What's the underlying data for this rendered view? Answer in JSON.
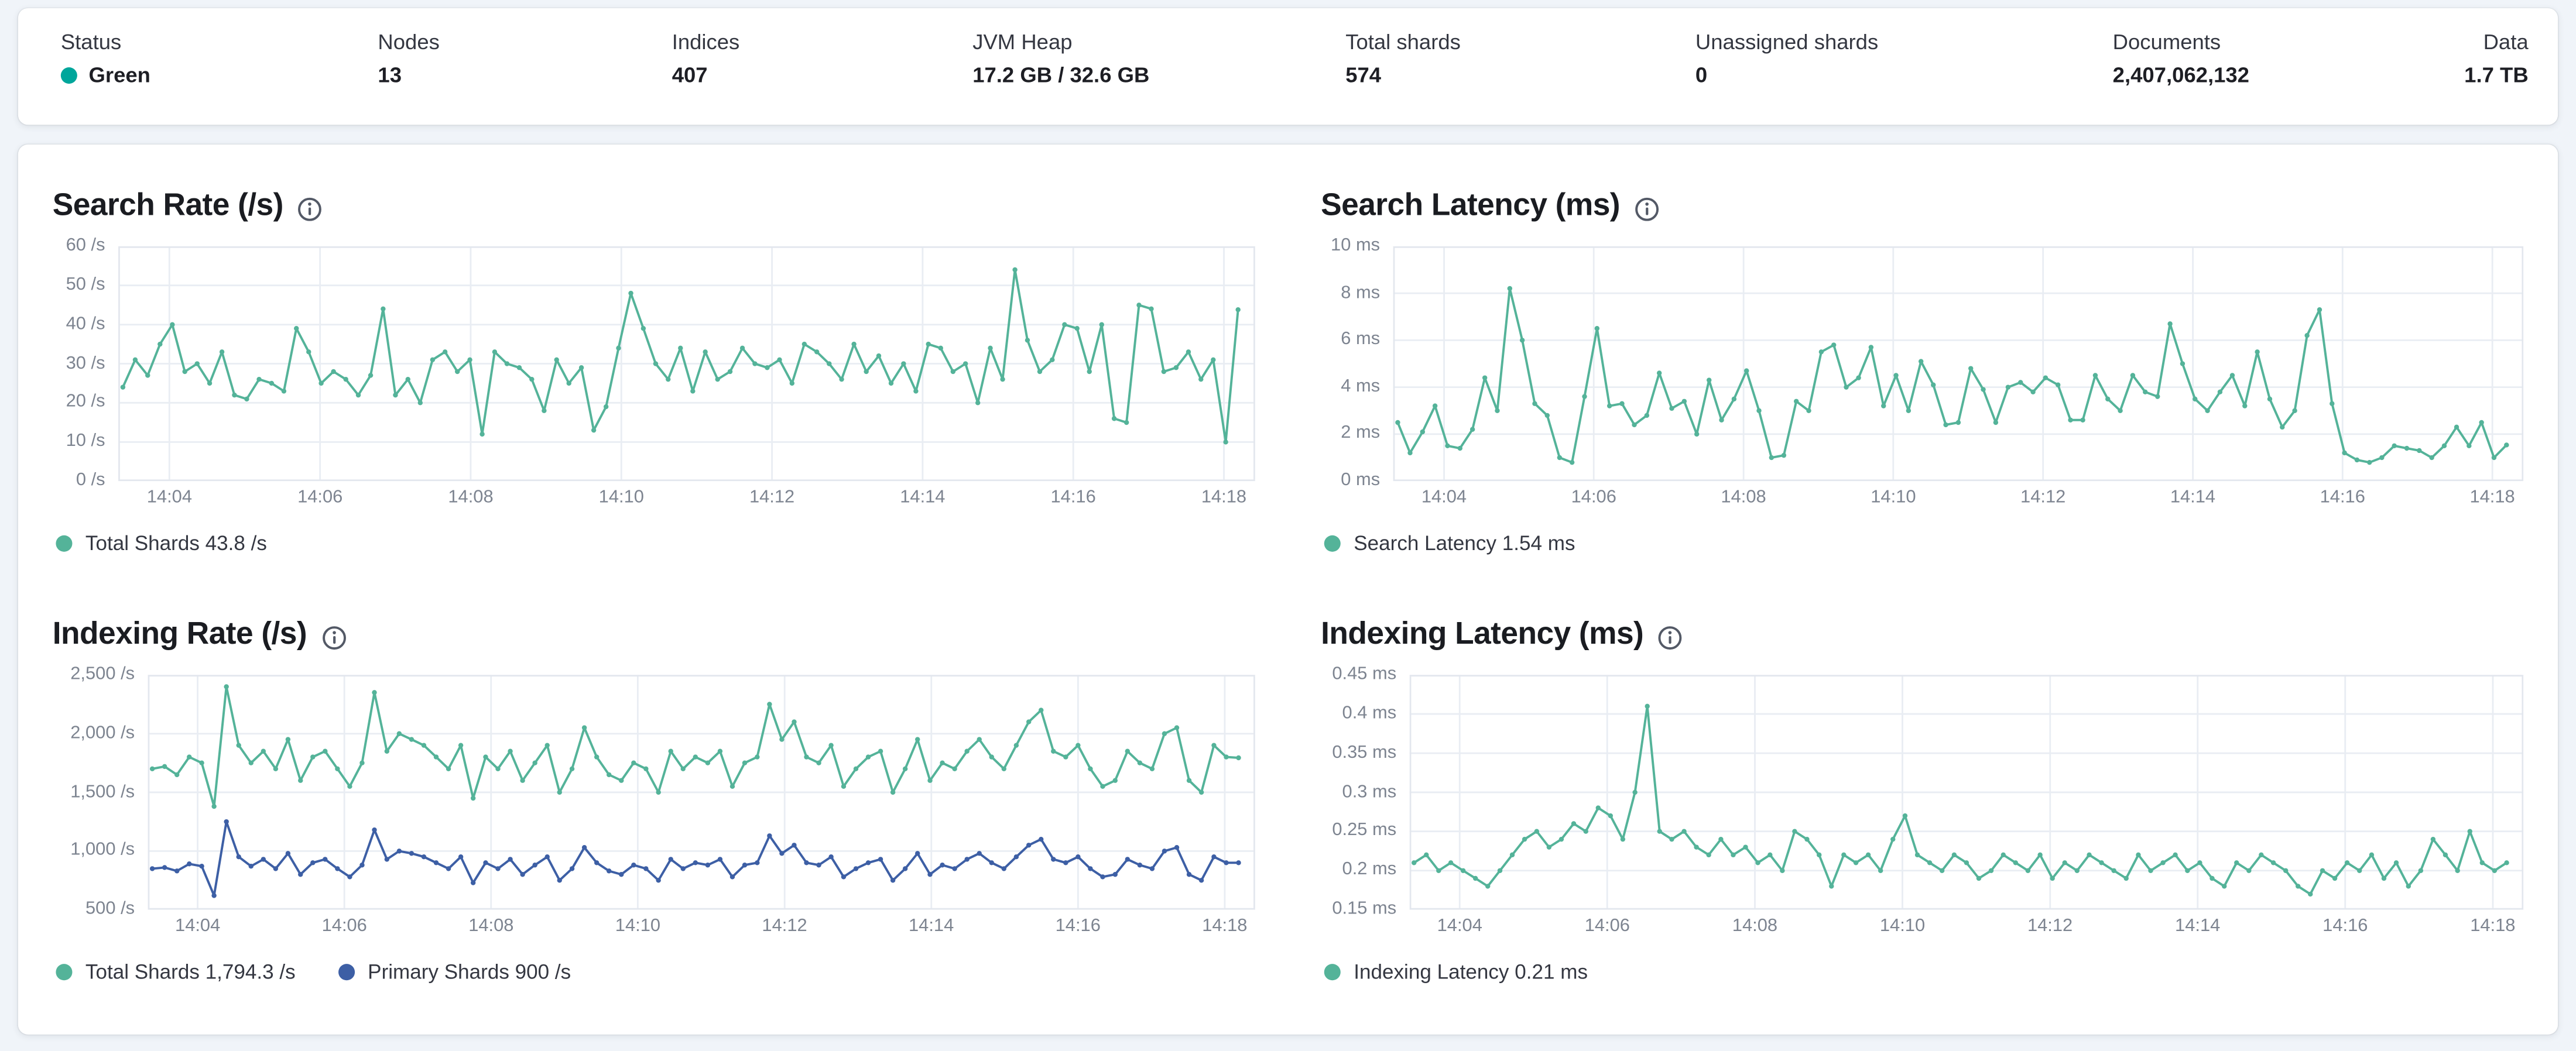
{
  "stats_bar": {
    "items": [
      {
        "label": "Status",
        "value": "Green",
        "type": "health"
      },
      {
        "label": "Nodes",
        "value": "13"
      },
      {
        "label": "Indices",
        "value": "407"
      },
      {
        "label": "JVM Heap",
        "value": "17.2 GB / 32.6 GB"
      },
      {
        "label": "Total shards",
        "value": "574"
      },
      {
        "label": "Unassigned shards",
        "value": "0"
      },
      {
        "label": "Documents",
        "value": "2,407,062,132"
      },
      {
        "label": "Data",
        "value": "1.7 TB"
      }
    ]
  },
  "colors": {
    "health_green": "#00a69b",
    "teal": "#54b399",
    "blue": "#3d5fa5",
    "grid": "#e9edf3",
    "page_bg": "#f0f4f9"
  },
  "chart_data": [
    {
      "type": "line",
      "title": "Search Rate (/s)",
      "ylabel": "/s",
      "ylim": [
        0,
        60
      ],
      "x_ticks": [
        "14:04",
        "14:06",
        "14:08",
        "14:10",
        "14:12",
        "14:14",
        "14:16",
        "14:18"
      ],
      "y_ticks": [
        {
          "v": 0,
          "label": "0 /s"
        },
        {
          "v": 10,
          "label": "10 /s"
        },
        {
          "v": 20,
          "label": "20 /s"
        },
        {
          "v": 30,
          "label": "30 /s"
        },
        {
          "v": 40,
          "label": "40 /s"
        },
        {
          "v": 50,
          "label": "50 /s"
        },
        {
          "v": 60,
          "label": "60 /s"
        }
      ],
      "series": [
        {
          "name": "Total Shards",
          "color": "#54b399",
          "values": [
            24,
            31,
            27,
            35,
            40,
            28,
            30,
            25,
            33,
            22,
            21,
            26,
            25,
            23,
            39,
            33,
            25,
            28,
            26,
            22,
            27,
            44,
            22,
            26,
            20,
            31,
            33,
            28,
            31,
            12,
            33,
            30,
            29,
            26,
            18,
            31,
            25,
            29,
            13,
            19,
            34,
            48,
            39,
            30,
            26,
            34,
            23,
            33,
            26,
            28,
            34,
            30,
            29,
            31,
            25,
            35,
            33,
            30,
            26,
            35,
            28,
            32,
            25,
            30,
            23,
            35,
            34,
            28,
            30,
            20,
            34,
            26,
            54,
            36,
            28,
            31,
            40,
            39,
            28,
            40,
            16,
            15,
            45,
            44,
            28,
            29,
            33,
            26,
            31,
            10,
            43.8
          ]
        }
      ],
      "legend": [
        {
          "label": "Total Shards 43.8 /s",
          "color": "#54b399"
        }
      ]
    },
    {
      "type": "line",
      "title": "Search Latency (ms)",
      "ylabel": "ms",
      "ylim": [
        0,
        10
      ],
      "x_ticks": [
        "14:04",
        "14:06",
        "14:08",
        "14:10",
        "14:12",
        "14:14",
        "14:16",
        "14:18"
      ],
      "y_ticks": [
        {
          "v": 0,
          "label": "0 ms"
        },
        {
          "v": 2,
          "label": "2 ms"
        },
        {
          "v": 4,
          "label": "4 ms"
        },
        {
          "v": 6,
          "label": "6 ms"
        },
        {
          "v": 8,
          "label": "8 ms"
        },
        {
          "v": 10,
          "label": "10 ms"
        }
      ],
      "series": [
        {
          "name": "Search Latency",
          "color": "#54b399",
          "values": [
            2.5,
            1.2,
            2.1,
            3.2,
            1.5,
            1.4,
            2.2,
            4.4,
            3.0,
            8.2,
            6.0,
            3.3,
            2.8,
            1.0,
            0.8,
            3.6,
            6.5,
            3.2,
            3.3,
            2.4,
            2.8,
            4.6,
            3.1,
            3.4,
            2.0,
            4.3,
            2.6,
            3.5,
            4.7,
            3.0,
            1.0,
            1.1,
            3.4,
            3.0,
            5.5,
            5.8,
            4.0,
            4.4,
            5.7,
            3.2,
            4.5,
            3.0,
            5.1,
            4.1,
            2.4,
            2.5,
            4.8,
            3.9,
            2.5,
            4.0,
            4.2,
            3.8,
            4.4,
            4.1,
            2.6,
            2.6,
            4.5,
            3.5,
            3.0,
            4.5,
            3.8,
            3.6,
            6.7,
            5.0,
            3.5,
            3.0,
            3.8,
            4.5,
            3.2,
            5.5,
            3.5,
            2.3,
            3.0,
            6.2,
            7.3,
            3.3,
            1.2,
            0.9,
            0.8,
            1.0,
            1.5,
            1.4,
            1.3,
            1.0,
            1.5,
            2.3,
            1.5,
            2.5,
            1.0,
            1.54
          ]
        }
      ],
      "legend": [
        {
          "label": "Search Latency 1.54 ms",
          "color": "#54b399"
        }
      ]
    },
    {
      "type": "line",
      "title": "Indexing Rate (/s)",
      "ylabel": "/s",
      "ylim": [
        500,
        2500
      ],
      "x_ticks": [
        "14:04",
        "14:06",
        "14:08",
        "14:10",
        "14:12",
        "14:14",
        "14:16",
        "14:18"
      ],
      "y_ticks": [
        {
          "v": 500,
          "label": "500 /s"
        },
        {
          "v": 1000,
          "label": "1,000 /s"
        },
        {
          "v": 1500,
          "label": "1,500 /s"
        },
        {
          "v": 2000,
          "label": "2,000 /s"
        },
        {
          "v": 2500,
          "label": "2,500 /s"
        }
      ],
      "series": [
        {
          "name": "Total Shards",
          "color": "#54b399",
          "values": [
            1700,
            1720,
            1650,
            1800,
            1750,
            1380,
            2400,
            1900,
            1750,
            1850,
            1700,
            1950,
            1600,
            1800,
            1850,
            1700,
            1550,
            1750,
            2350,
            1850,
            2000,
            1950,
            1900,
            1800,
            1700,
            1900,
            1450,
            1800,
            1700,
            1850,
            1600,
            1750,
            1900,
            1500,
            1700,
            2050,
            1800,
            1650,
            1600,
            1750,
            1700,
            1500,
            1850,
            1700,
            1800,
            1750,
            1850,
            1550,
            1750,
            1800,
            2250,
            1950,
            2100,
            1800,
            1750,
            1900,
            1550,
            1700,
            1800,
            1850,
            1500,
            1700,
            1950,
            1600,
            1750,
            1700,
            1850,
            1950,
            1800,
            1700,
            1900,
            2100,
            2200,
            1850,
            1800,
            1900,
            1700,
            1550,
            1600,
            1850,
            1750,
            1700,
            2000,
            2050,
            1600,
            1500,
            1900,
            1800,
            1794.3
          ]
        },
        {
          "name": "Primary Shards",
          "color": "#3d5fa5",
          "values": [
            850,
            860,
            830,
            890,
            870,
            620,
            1250,
            950,
            870,
            930,
            850,
            980,
            800,
            900,
            930,
            850,
            780,
            880,
            1180,
            930,
            1000,
            980,
            950,
            900,
            850,
            950,
            730,
            900,
            850,
            930,
            800,
            880,
            950,
            750,
            850,
            1030,
            900,
            830,
            800,
            880,
            850,
            750,
            930,
            850,
            900,
            880,
            930,
            780,
            880,
            900,
            1130,
            980,
            1050,
            900,
            880,
            950,
            780,
            850,
            900,
            930,
            750,
            850,
            980,
            800,
            880,
            850,
            930,
            980,
            900,
            850,
            950,
            1050,
            1100,
            930,
            900,
            950,
            850,
            780,
            800,
            930,
            880,
            850,
            1000,
            1030,
            800,
            750,
            950,
            900,
            900
          ]
        }
      ],
      "legend": [
        {
          "label": "Total Shards 1,794.3 /s",
          "color": "#54b399"
        },
        {
          "label": "Primary Shards 900 /s",
          "color": "#3d5fa5"
        }
      ]
    },
    {
      "type": "line",
      "title": "Indexing Latency (ms)",
      "ylabel": "ms",
      "ylim": [
        0.15,
        0.45
      ],
      "x_ticks": [
        "14:04",
        "14:06",
        "14:08",
        "14:10",
        "14:12",
        "14:14",
        "14:16",
        "14:18"
      ],
      "y_ticks": [
        {
          "v": 0.15,
          "label": "0.15 ms"
        },
        {
          "v": 0.2,
          "label": "0.2 ms"
        },
        {
          "v": 0.25,
          "label": "0.25 ms"
        },
        {
          "v": 0.3,
          "label": "0.3 ms"
        },
        {
          "v": 0.35,
          "label": "0.35 ms"
        },
        {
          "v": 0.4,
          "label": "0.4 ms"
        },
        {
          "v": 0.45,
          "label": "0.45 ms"
        }
      ],
      "series": [
        {
          "name": "Indexing Latency",
          "color": "#54b399",
          "values": [
            0.21,
            0.22,
            0.2,
            0.21,
            0.2,
            0.19,
            0.18,
            0.2,
            0.22,
            0.24,
            0.25,
            0.23,
            0.24,
            0.26,
            0.25,
            0.28,
            0.27,
            0.24,
            0.3,
            0.41,
            0.25,
            0.24,
            0.25,
            0.23,
            0.22,
            0.24,
            0.22,
            0.23,
            0.21,
            0.22,
            0.2,
            0.25,
            0.24,
            0.22,
            0.18,
            0.22,
            0.21,
            0.22,
            0.2,
            0.24,
            0.27,
            0.22,
            0.21,
            0.2,
            0.22,
            0.21,
            0.19,
            0.2,
            0.22,
            0.21,
            0.2,
            0.22,
            0.19,
            0.21,
            0.2,
            0.22,
            0.21,
            0.2,
            0.19,
            0.22,
            0.2,
            0.21,
            0.22,
            0.2,
            0.21,
            0.19,
            0.18,
            0.21,
            0.2,
            0.22,
            0.21,
            0.2,
            0.18,
            0.17,
            0.2,
            0.19,
            0.21,
            0.2,
            0.22,
            0.19,
            0.21,
            0.18,
            0.2,
            0.24,
            0.22,
            0.2,
            0.25,
            0.21,
            0.2,
            0.21
          ]
        }
      ],
      "legend": [
        {
          "label": "Indexing Latency 0.21 ms",
          "color": "#54b399"
        }
      ]
    }
  ]
}
